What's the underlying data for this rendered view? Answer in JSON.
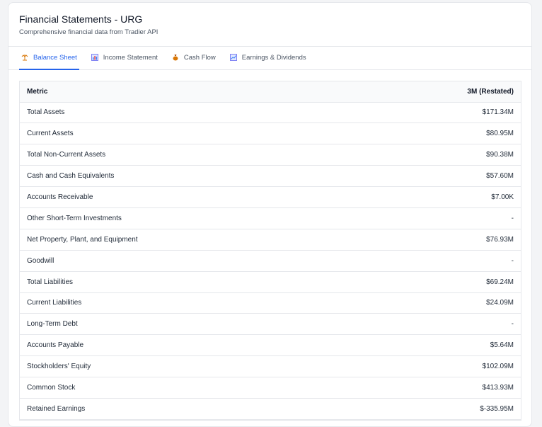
{
  "header": {
    "title": "Financial Statements - URG",
    "subtitle": "Comprehensive financial data from Tradier API"
  },
  "tabs": [
    {
      "label": "Balance Sheet",
      "icon": "scale-icon",
      "active": true
    },
    {
      "label": "Income Statement",
      "icon": "bar-chart-icon",
      "active": false
    },
    {
      "label": "Cash Flow",
      "icon": "money-bag-icon",
      "active": false
    },
    {
      "label": "Earnings & Dividends",
      "icon": "line-chart-icon",
      "active": false
    }
  ],
  "table": {
    "columns": [
      "Metric",
      "3M (Restated)"
    ],
    "rows": [
      [
        "Total Assets",
        "$171.34M"
      ],
      [
        "Current Assets",
        "$80.95M"
      ],
      [
        "Total Non-Current Assets",
        "$90.38M"
      ],
      [
        "Cash and Cash Equivalents",
        "$57.60M"
      ],
      [
        "Accounts Receivable",
        "$7.00K"
      ],
      [
        "Other Short-Term Investments",
        "-"
      ],
      [
        "Net Property, Plant, and Equipment",
        "$76.93M"
      ],
      [
        "Goodwill",
        "-"
      ],
      [
        "Total Liabilities",
        "$69.24M"
      ],
      [
        "Current Liabilities",
        "$24.09M"
      ],
      [
        "Long-Term Debt",
        "-"
      ],
      [
        "Accounts Payable",
        "$5.64M"
      ],
      [
        "Stockholders' Equity",
        "$102.09M"
      ],
      [
        "Common Stock",
        "$413.93M"
      ],
      [
        "Retained Earnings",
        "$-335.95M"
      ]
    ]
  },
  "colors": {
    "accent": "#2563eb",
    "border": "#e5e7eb",
    "header_bg": "#f9fafb"
  }
}
